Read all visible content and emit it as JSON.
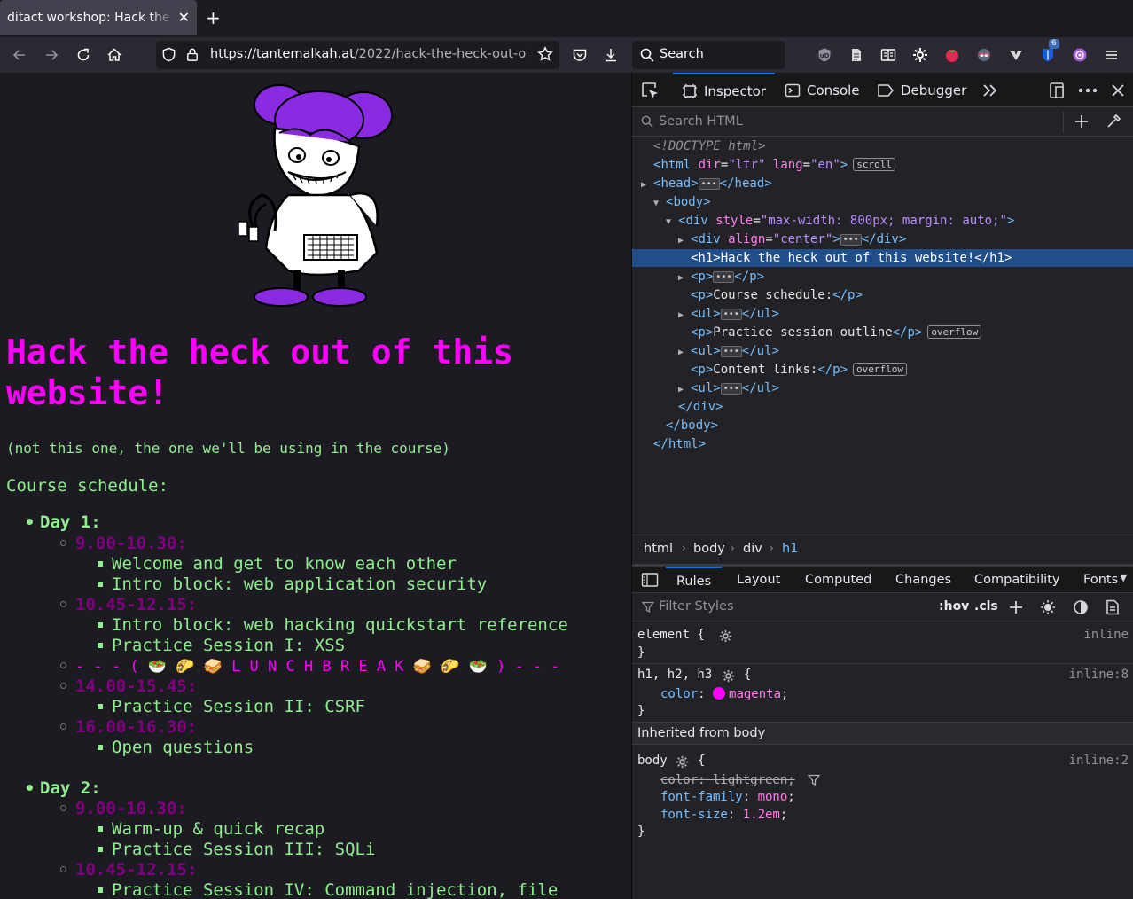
{
  "browser": {
    "tab_title": "ditact workshop: Hack the heck",
    "tab_close": "✕",
    "new_tab": "+",
    "url_host": "https://tantemalkah.at",
    "url_path": "/2022/hack-the-heck-out-of-t",
    "search_placeholder": "Search",
    "extension_badge": "6"
  },
  "page": {
    "title": "Hack the heck out of this website!",
    "note": "(not this one, the one we'll be using in the course)",
    "schedule_label": "Course schedule:",
    "day1": {
      "label": "Day 1:",
      "slot1_time": "9.00-10.30:",
      "slot1_items": [
        "Welcome and get to know each other",
        "Intro block: web application security"
      ],
      "slot2_time": "10.45-12.15:",
      "slot2_items": [
        "Intro block: web hacking quickstart reference",
        "Practice Session I: XSS"
      ],
      "lunch": "- - - ( 🥗 🌮 🥪  L U N C H   B R E A K 🥪 🌮 🥗 ) - - -",
      "slot3_time": "14.00-15.45:",
      "slot3_items": [
        "Practice Session II: CSRF"
      ],
      "slot4_time": "16.00-16.30:",
      "slot4_items": [
        "Open questions"
      ]
    },
    "day2": {
      "label": "Day 2:",
      "slot1_time": "9.00-10.30:",
      "slot1_items": [
        "Warm-up & quick recap",
        "Practice Session III: SQLi"
      ],
      "slot2_time": "10.45-12.15:",
      "slot2_items": [
        "Practice Session IV: Command injection, file"
      ]
    }
  },
  "devtools": {
    "tabs": {
      "inspector": "Inspector",
      "console": "Console",
      "debugger": "Debugger"
    },
    "search_placeholder": "Search HTML",
    "markup": {
      "doctype": "<!DOCTYPE html>",
      "html_open_tag": "html",
      "html_attrs": [
        {
          "name": "dir",
          "value": "\"ltr\""
        },
        {
          "name": "lang",
          "value": "\"en\""
        }
      ],
      "scroll_badge": "scroll",
      "head": "head",
      "body": "body",
      "div_tag": "div",
      "div_style_attr": "style",
      "div_style_value": "\"max-width: 800px; margin: auto;\"",
      "div_align_attr": "align",
      "div_align_value": "\"center\"",
      "h1_text": "Hack the heck out of this website!",
      "p_text_1": "Course schedule:",
      "p_text_2": "Practice session outline",
      "p_text_3": "Content links:",
      "overflow_badge": "overflow",
      "ellipsis": "•••"
    },
    "breadcrumbs": [
      "html",
      "body",
      "div",
      "h1"
    ],
    "rule_tabs": [
      "Rules",
      "Layout",
      "Computed",
      "Changes",
      "Compatibility",
      "Fonts"
    ],
    "filter_placeholder": "Filter Styles",
    "filter_tools": {
      "hov": ":hov",
      "cls": ".cls"
    },
    "rules": {
      "element_selector": "element {",
      "element_source": "inline",
      "h_selector": "h1, h2, h3",
      "h_source": "inline:8",
      "h_prop": "color",
      "h_value": "magenta",
      "inherited_label": "Inherited from body",
      "body_selector": "body",
      "body_source": "inline:2",
      "body_prop1": "color: lightgreen;",
      "body_prop2": "font-family",
      "body_value2": "mono",
      "body_prop3": "font-size",
      "body_value3": "1.2em",
      "open_brace": "{",
      "close_brace": "}"
    }
  },
  "colors": {
    "heading": "#ff00ff",
    "text": "#90ee90",
    "time": "#800080",
    "page_bg": "#1c1b22",
    "devtools_selection": "#204e8a"
  }
}
